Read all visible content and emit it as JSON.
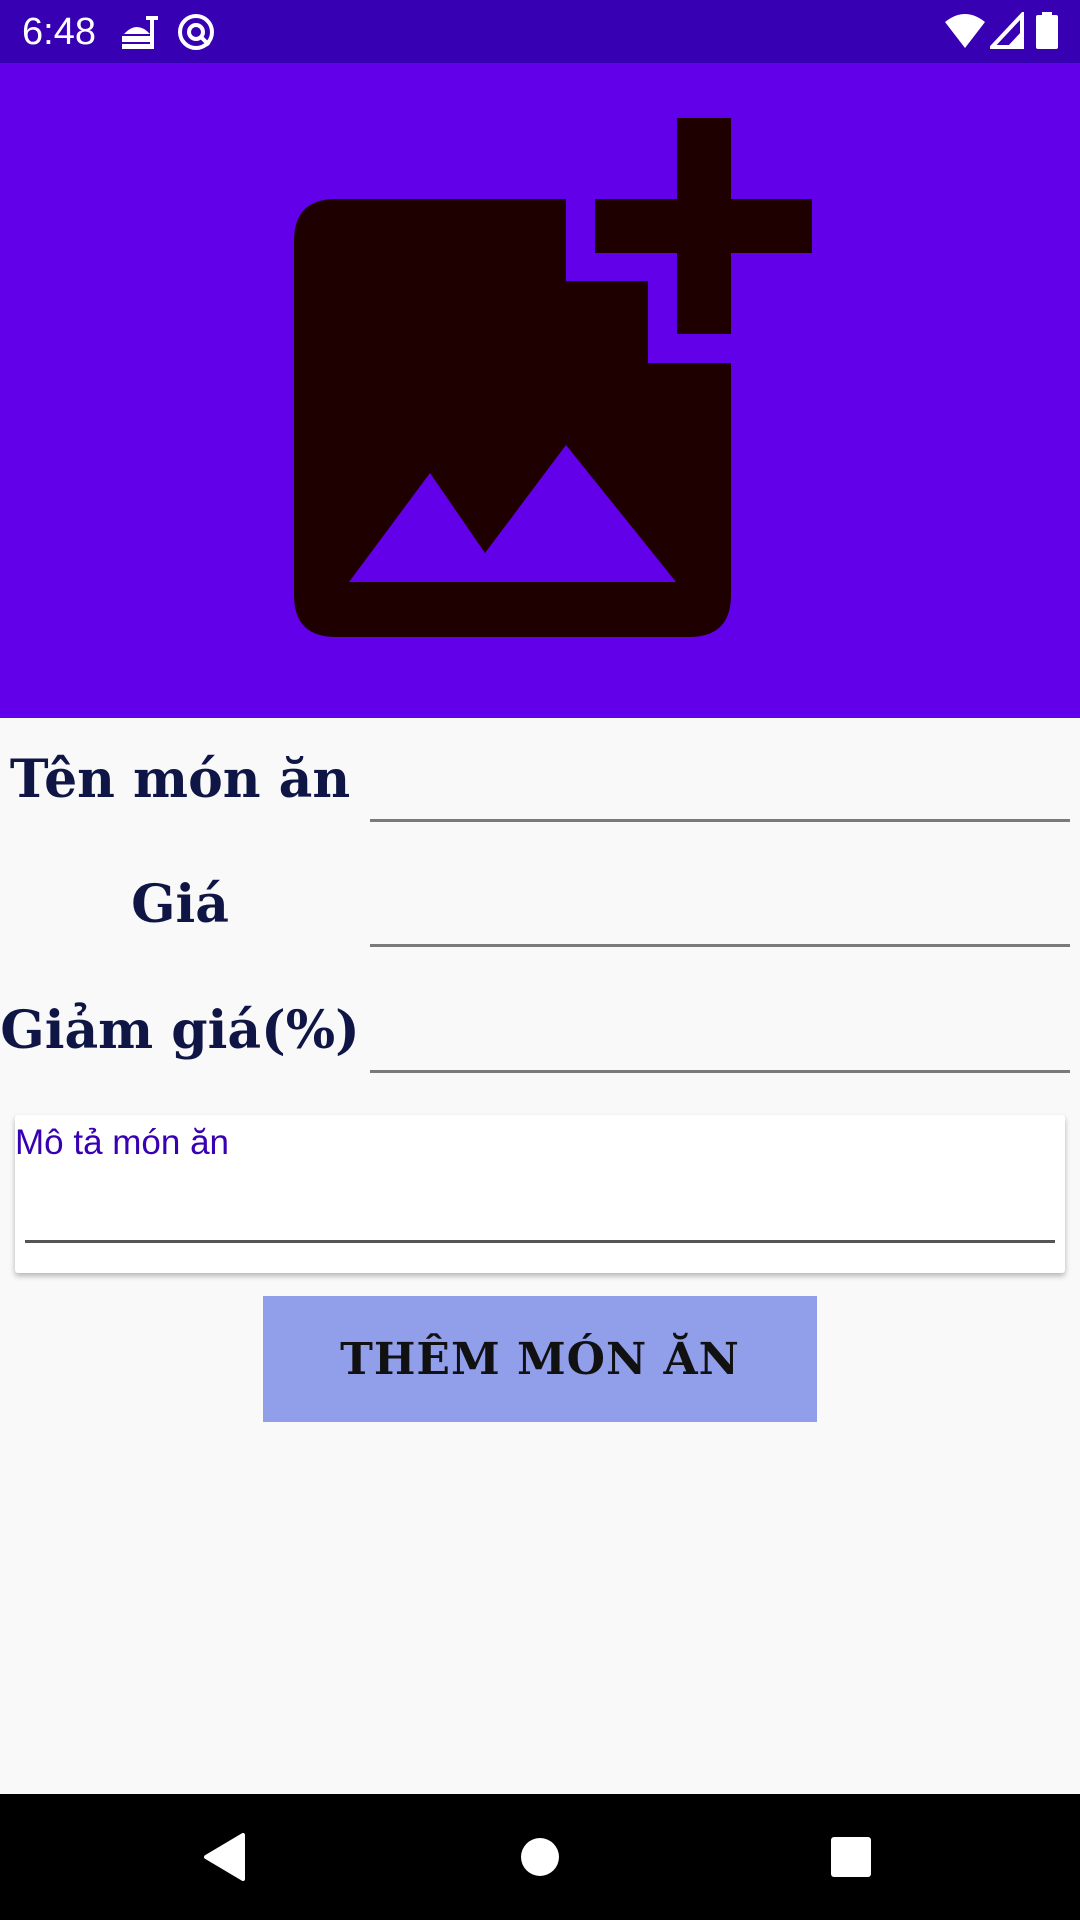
{
  "status_bar": {
    "time": "6:48",
    "icons": [
      "food-notification-icon",
      "sync-circle-icon",
      "wifi-icon",
      "signal-icon",
      "battery-icon"
    ]
  },
  "image_picker": {
    "icon": "add-photo-icon",
    "background_color": "#6200ea",
    "icon_color": "#1e0000"
  },
  "form": {
    "name_label": "Tên món ăn",
    "name_value": "",
    "price_label": "Giá",
    "price_value": "",
    "discount_label": "Giảm giá(%)",
    "discount_value": "",
    "description_label": "Mô tả món ăn",
    "description_value": ""
  },
  "submit_button": {
    "label": "THÊM MÓN ĂN",
    "color": "#919ee9"
  },
  "nav_bar": {
    "buttons": [
      "back-icon",
      "home-icon",
      "recents-icon"
    ]
  }
}
